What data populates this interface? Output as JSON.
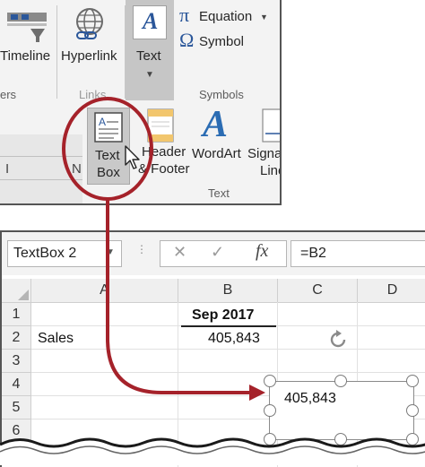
{
  "ribbon": {
    "timeline_label": "Timeline",
    "hyperlink_label": "Hyperlink",
    "text_label": "Text",
    "equation_label": "Equation",
    "symbol_label": "Symbol",
    "group_filters_partial": "ers",
    "group_links_partial": "Links",
    "group_symbols": "Symbols",
    "textbox_line1": "Text",
    "textbox_line2": "Box",
    "header_line1": "Header",
    "header_line2": "& Footer",
    "wordart_label": "WordArt",
    "signature_line1": "Signa",
    "signature_line2": "Line",
    "group_text": "Text",
    "partial_n": "N",
    "partial_i": "I"
  },
  "formula_bar": {
    "name_box": "TextBox 2",
    "formula": "=B2",
    "cancel_symbol": "✕",
    "enter_symbol": "✓",
    "fx_symbol": "fx"
  },
  "sheet": {
    "columns": [
      "A",
      "B",
      "C",
      "D"
    ],
    "rows": [
      "1",
      "2",
      "3",
      "4",
      "5",
      "6"
    ],
    "b1": "Sep 2017",
    "a2": "Sales",
    "b2": "405,843"
  },
  "textbox": {
    "value": "405,843"
  },
  "colors": {
    "callout_red": "#a5222a",
    "ribbon_bg": "#f3f3f3",
    "selected_bg": "#c6c6c6",
    "accent_blue": "#2b579a"
  }
}
